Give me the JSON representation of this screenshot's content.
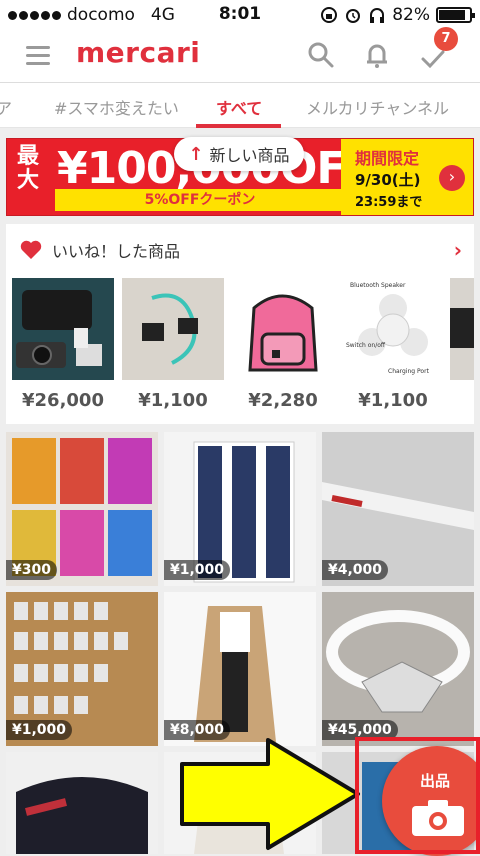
{
  "status_bar": {
    "carrier": "docomo",
    "network": "4G",
    "time": "8:01",
    "battery": "82%"
  },
  "header": {
    "logo": "mercari",
    "notification_count": "7"
  },
  "tabs": [
    {
      "label": "ア"
    },
    {
      "label": "#スマホ変えたい"
    },
    {
      "label": "すべて"
    },
    {
      "label": "メルカリチャンネル"
    }
  ],
  "banner": {
    "left_label": "最大",
    "amount": "¥100,000OFF",
    "coupon": "5%OFFクーポン",
    "limited": "期間限定",
    "date": "9/30(土)",
    "until": "23:59まで"
  },
  "new_items_pill": "新しい商品",
  "liked": {
    "title": "いいね！した商品",
    "items": [
      {
        "price": "¥26,000"
      },
      {
        "price": "¥1,100"
      },
      {
        "price": "¥2,280"
      },
      {
        "price": "¥1,100"
      }
    ]
  },
  "grid": [
    {
      "price": "¥300"
    },
    {
      "price": "¥1,000"
    },
    {
      "price": "¥4,000"
    },
    {
      "price": "¥1,000"
    },
    {
      "price": "¥8,000"
    },
    {
      "price": "¥45,000"
    },
    {
      "price": ""
    },
    {
      "price": ""
    },
    {
      "price": ""
    }
  ],
  "speaker_labels": {
    "top": "Bluetooth Speaker",
    "left": "Switch on/off",
    "bottom": "Charging Port"
  },
  "sell_button": {
    "label": "出品"
  },
  "colors": {
    "brand": "#e0303d",
    "banner_red": "#e8202a",
    "banner_yellow": "#ffe100",
    "highlight": "#e8202a",
    "arrow": "#ffff00"
  }
}
